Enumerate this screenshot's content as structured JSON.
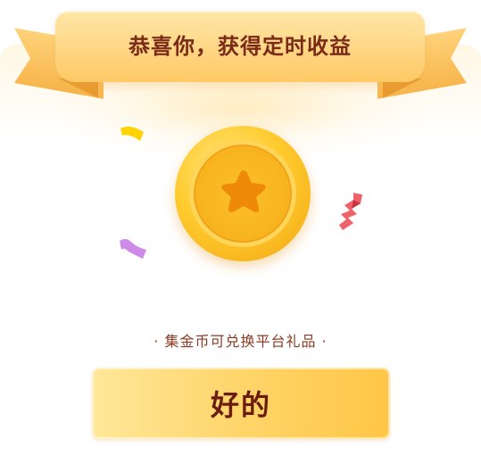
{
  "dialog": {
    "title": "恭喜你，获得定时收益",
    "coin_icon": "star-coin-icon",
    "subtitle_prefix": "·",
    "subtitle": "集金币可兑换平台礼品",
    "subtitle_suffix": "·",
    "ok_label": "好的"
  },
  "colors": {
    "title_text": "#7a2a16",
    "subtitle_text": "#8a3a22",
    "button_text": "#6a1c10",
    "gold": "#ffcb2e",
    "ribbon": "#ffd98b"
  }
}
